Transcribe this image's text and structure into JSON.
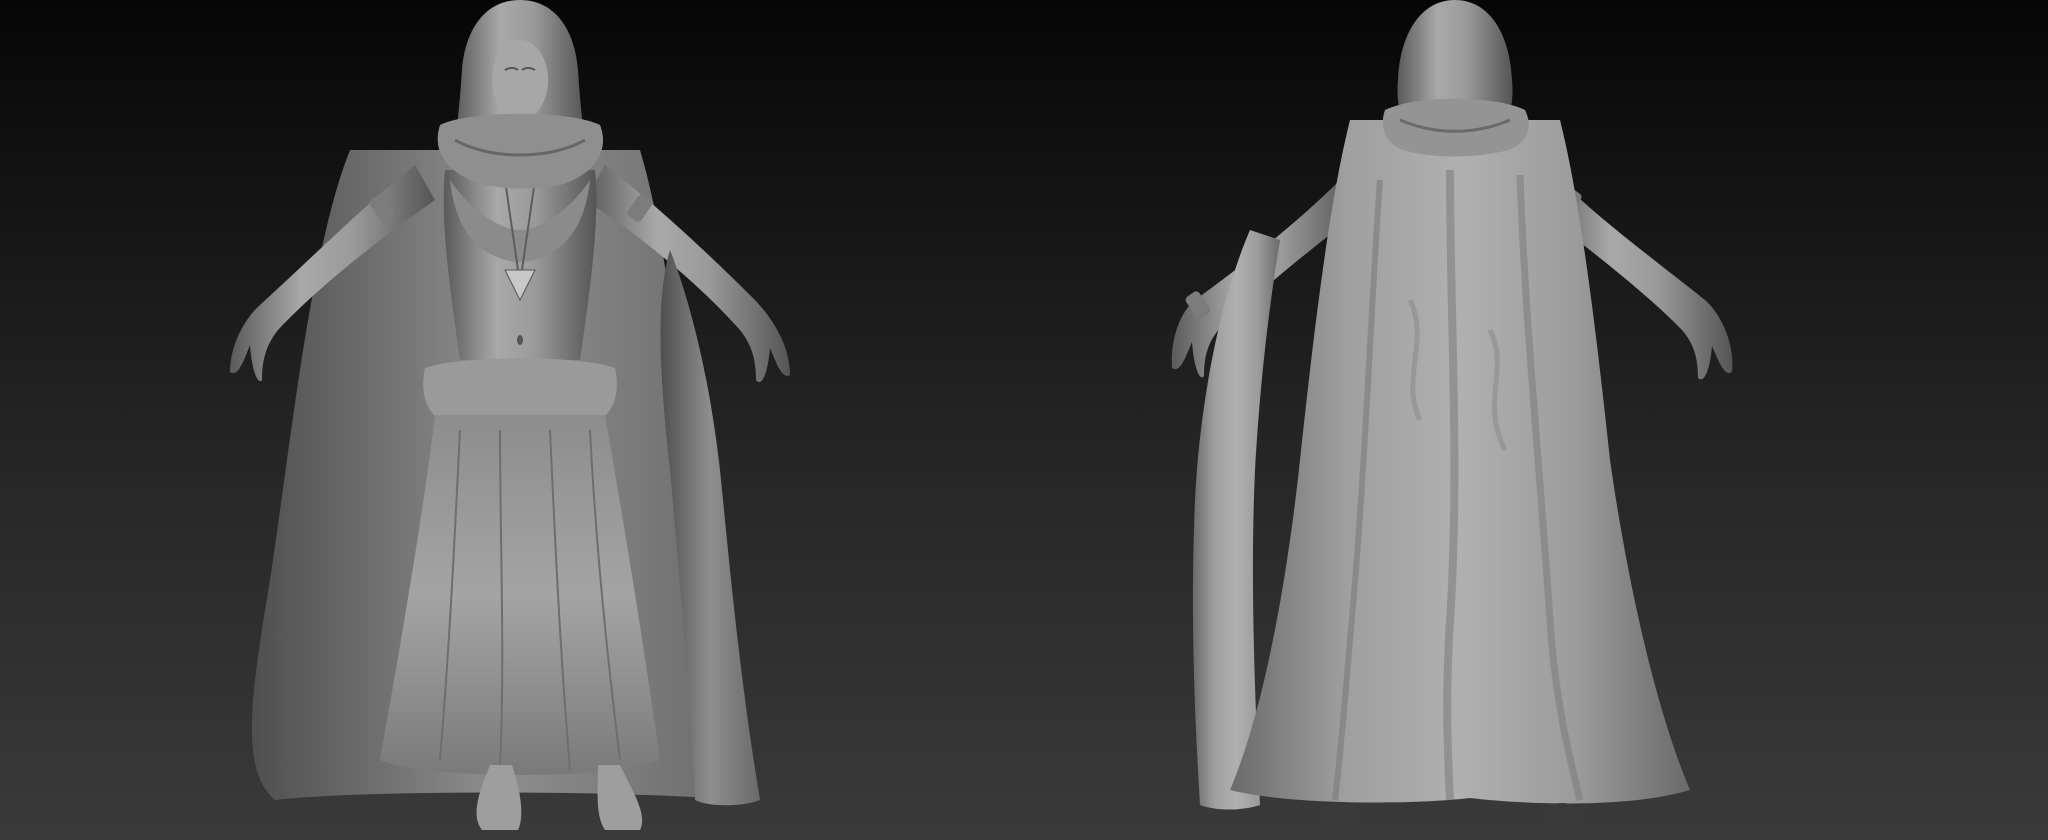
{
  "viewport": {
    "background_top": "#060606",
    "background_bottom": "#3a3a3a",
    "material_light": "#c4c4c4",
    "material_mid": "#8a8a8a",
    "material_dark": "#4a4a4a"
  },
  "models": [
    {
      "id": "front",
      "view": "front",
      "subject": "hooded-robed-figure-sculpt"
    },
    {
      "id": "back",
      "view": "back",
      "subject": "hooded-robed-figure-sculpt"
    }
  ]
}
